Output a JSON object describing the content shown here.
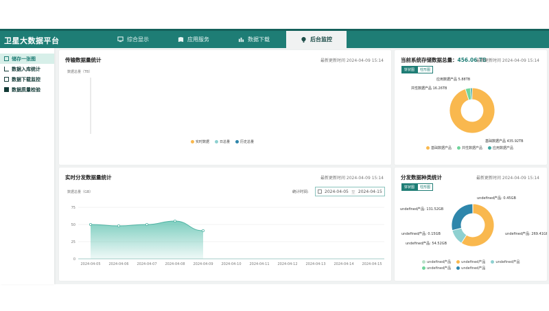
{
  "app": {
    "title": "卫星大数据平台"
  },
  "nav": [
    {
      "label": "综合显示",
      "icon": "display-icon"
    },
    {
      "label": "应用服务",
      "icon": "service-icon"
    },
    {
      "label": "数据下载",
      "icon": "chart-icon"
    },
    {
      "label": "后台监控",
      "icon": "monitor-icon"
    }
  ],
  "sidebar": {
    "items": [
      {
        "label": "储存一张图"
      },
      {
        "label": "数据入库统计"
      },
      {
        "label": "数据下载监控"
      },
      {
        "label": "数据质量检验"
      }
    ]
  },
  "panels": {
    "transfer": {
      "title": "传输数据量统计",
      "time": "最新更新时间 2024-04-09 15:14",
      "yname": "数据总量（TB）",
      "legend": [
        "实时数据",
        "日总量",
        "历史总量"
      ]
    },
    "storage": {
      "title_prefix": "当前系统存储数据总量：",
      "total": "456.06 TB",
      "time": "最新更新时间 2024-04-09 15:14",
      "toggle": [
        "饼状图",
        "柱形图"
      ],
      "slice_labels": [
        "应用数据产品 5.88TB",
        "共性数据产品 16.26TB",
        "基础数据产品 435.92TB"
      ],
      "legend": [
        "基础数据产品",
        "共性数据产品",
        "应用数据产品"
      ]
    },
    "realtime": {
      "title": "实时分发数据量统计",
      "time": "最新更新时间 2024-04-09 15:14",
      "range_label": "统计时间:",
      "date_from": "2024-04-05",
      "date_sep": "至",
      "date_to": "2024-04-15",
      "yname": "数据总量（GB）"
    },
    "category": {
      "title": "分发数据种类统计",
      "time": "最新更新时间 2024-04-09 15:14",
      "toggle": [
        "饼状图",
        "柱形图"
      ],
      "slice_labels": [
        "undefined产品: 0.45GB",
        "undefined产品: 131.52GB",
        "undefined产品: 0.15GB",
        "undefined产品: 54.52GB",
        "undefined产品: 269.41GB"
      ],
      "legend": [
        "undefined产品",
        "undefined产品",
        "undefined产品",
        "undefined产品",
        "undefined产品"
      ]
    }
  },
  "chart_data": [
    {
      "type": "pie",
      "title": "",
      "donut": true,
      "labels": [
        "基础数据产品",
        "共性数据产品",
        "应用数据产品"
      ],
      "values": [
        435.92,
        16.26,
        5.88
      ],
      "unit": "TB",
      "colors": [
        "#f9b84e",
        "#6fd49b",
        "#3aa7a0"
      ],
      "legend_position": "bottom"
    },
    {
      "type": "area",
      "title": "",
      "ylabel": "数据总量（GB）",
      "categories": [
        "2024-04-05",
        "2024-04-06",
        "2024-04-07",
        "2024-04-08",
        "2024-04-09",
        "2024-04-10",
        "2024-04-11",
        "2024-04-12",
        "2024-04-13",
        "2024-04-14",
        "2024-04-15"
      ],
      "values": [
        50,
        48,
        50,
        55,
        41,
        null,
        null,
        null,
        null,
        null,
        null
      ],
      "ylim": [
        0,
        75
      ],
      "yticks": [
        0,
        25,
        50,
        75
      ],
      "color": "#5fc2b0",
      "grid": true
    },
    {
      "type": "pie",
      "title": "",
      "donut": true,
      "labels": [
        "undefined产品",
        "undefined产品",
        "undefined产品",
        "undefined产品",
        "undefined产品"
      ],
      "values": [
        269.41,
        54.52,
        0.15,
        131.52,
        0.45
      ],
      "unit": "GB",
      "colors": [
        "#f9b84e",
        "#8ed0d0",
        "#6fd49b",
        "#2e86ab",
        "#b8e0c8"
      ],
      "legend_position": "bottom"
    }
  ]
}
